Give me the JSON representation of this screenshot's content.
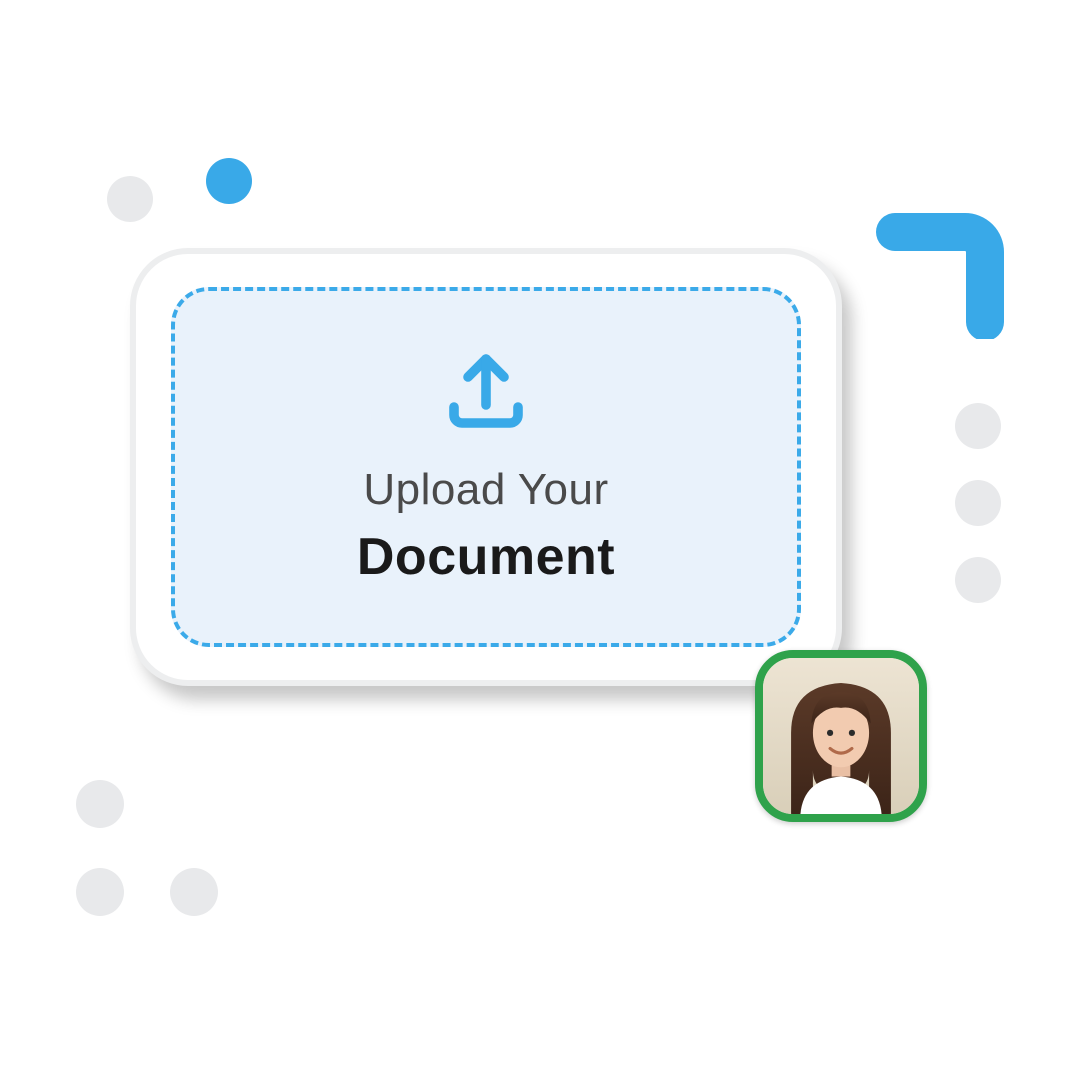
{
  "upload": {
    "line1": "Upload Your",
    "line2": "Document"
  },
  "colors": {
    "accent_blue": "#39A9E8",
    "dashed_blue": "#3BAAE9",
    "dropzone_bg": "#E9F2FB",
    "card_border": "#EDEEEF",
    "grey_dot": "#E8E9EB",
    "avatar_border": "#2FA24B"
  },
  "icons": {
    "upload": "upload-icon",
    "corner": "corner-accent-icon"
  }
}
